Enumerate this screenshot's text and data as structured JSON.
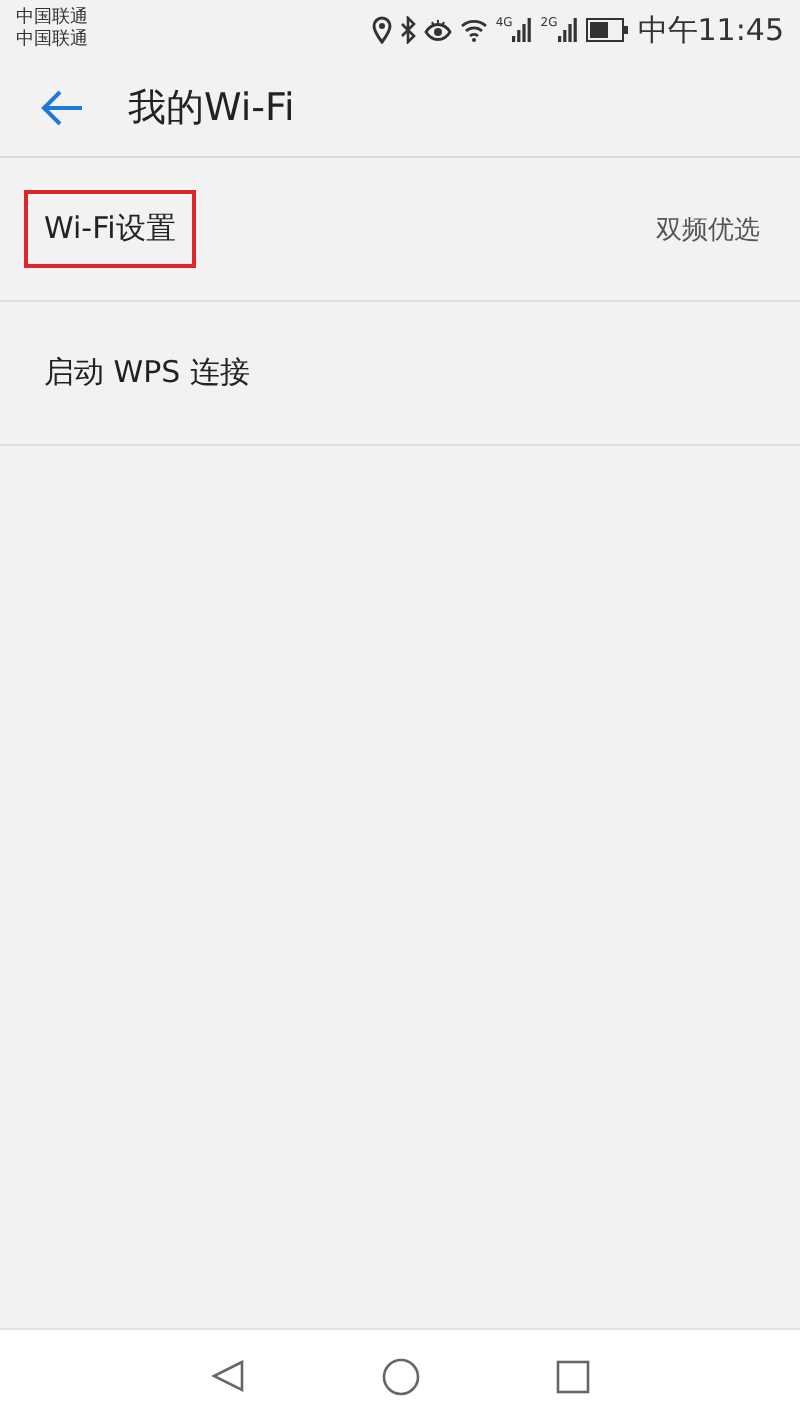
{
  "status_bar": {
    "carriers": [
      "中国联通",
      "中国联通"
    ],
    "network_labels": [
      "4G",
      "2G"
    ],
    "time": "中午11:45"
  },
  "header": {
    "title": "我的Wi-Fi"
  },
  "items": [
    {
      "label": "Wi-Fi设置",
      "value": "双频优选",
      "highlighted": true
    },
    {
      "label": "启动 WPS 连接",
      "highlighted": false
    }
  ]
}
